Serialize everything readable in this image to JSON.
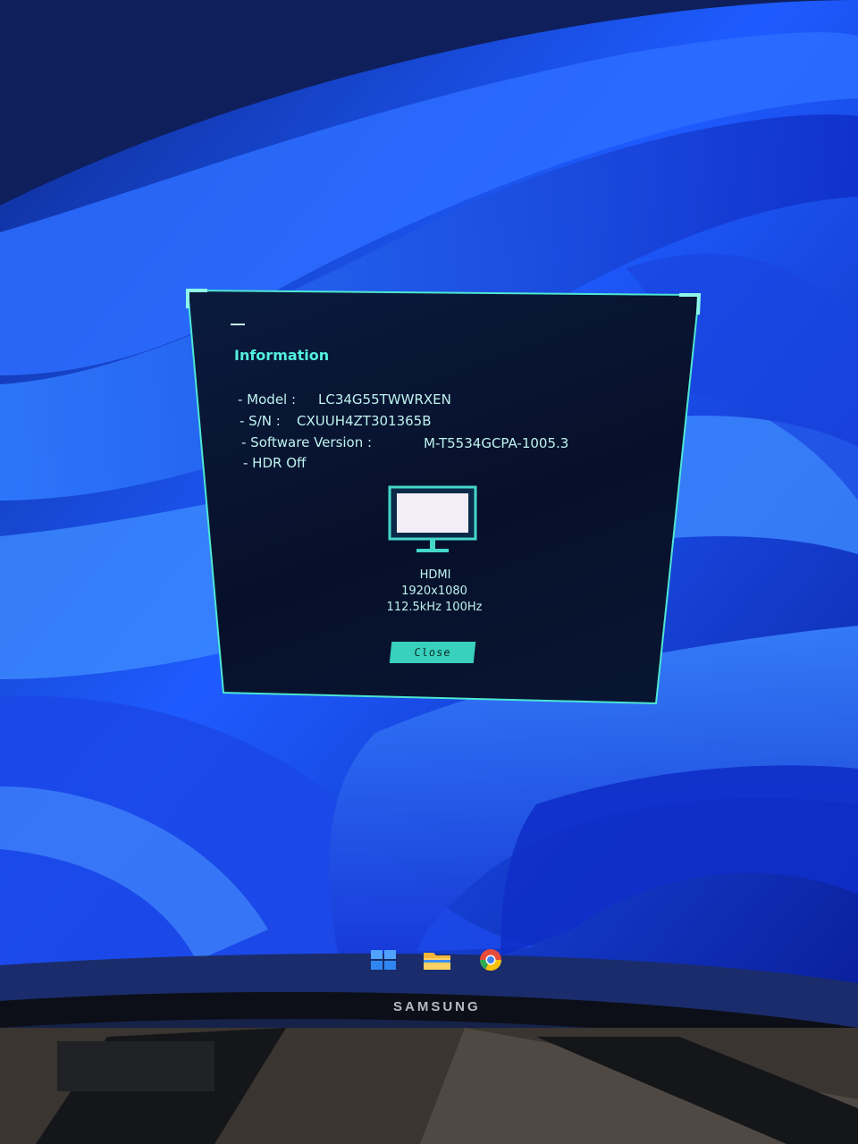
{
  "osd": {
    "title": "Information",
    "model_label": "- Model :",
    "model_value": "LC34G55TWWRXEN",
    "sn_label": "- S/N :",
    "sn_value": "CXUUH4ZT301365B",
    "sw_label": "- Software Version :",
    "sw_value": "M-T5534GCPA-1005.3",
    "hdr": "- HDR Off",
    "input": "HDMI",
    "resolution": "1920x1080",
    "frequency": "112.5kHz 100Hz",
    "close_label": "Close",
    "monitor_icon": "monitor-icon"
  },
  "taskbar": {
    "icons": [
      "windows-start-icon",
      "file-explorer-icon",
      "chrome-icon"
    ]
  },
  "bezel": {
    "brand": "SAMSUNG"
  },
  "colors": {
    "accent": "#39d1bd",
    "wallpaper": "#1a4bff",
    "osd_bg": "#07102a"
  }
}
